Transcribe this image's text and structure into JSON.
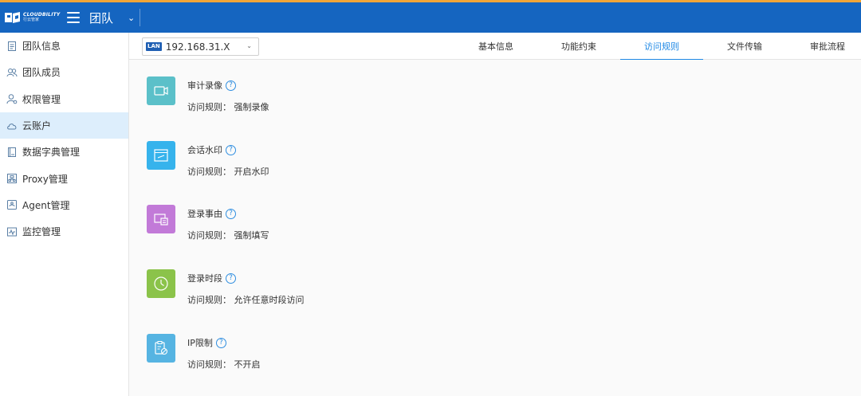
{
  "header": {
    "logo_en": "CLOUDBILITY",
    "logo_cn": "行云管家",
    "title": "团队"
  },
  "sidebar": {
    "items": [
      {
        "label": "团队信息",
        "icon": "document-icon"
      },
      {
        "label": "团队成员",
        "icon": "users-icon"
      },
      {
        "label": "权限管理",
        "icon": "user-permission-icon"
      },
      {
        "label": "云账户",
        "icon": "cloud-icon",
        "active": true
      },
      {
        "label": "数据字典管理",
        "icon": "book-icon"
      },
      {
        "label": "Proxy管理",
        "icon": "proxy-icon"
      },
      {
        "label": "Agent管理",
        "icon": "agent-icon"
      },
      {
        "label": "监控管理",
        "icon": "monitor-icon"
      }
    ]
  },
  "toolbar": {
    "lan_badge": "LAN",
    "lan_value": "192.168.31.X",
    "tabs": [
      "基本信息",
      "功能约束",
      "访问规则",
      "文件传输",
      "审批流程"
    ],
    "active_tab": "访问规则"
  },
  "rules": [
    {
      "title": "审计录像",
      "desc": "访问规则： 强制录像",
      "icon": "video-icon",
      "color": "#5bc0c9"
    },
    {
      "title": "会话水印",
      "desc": "访问规则： 开启水印",
      "icon": "watermark-icon",
      "color": "#36b3ec"
    },
    {
      "title": "登录事由",
      "desc": "访问规则： 强制填写",
      "icon": "login-reason-icon",
      "color": "#c27ad8"
    },
    {
      "title": "登录时段",
      "desc": "访问规则： 允许任意时段访问",
      "icon": "clock-icon",
      "color": "#8bc34a"
    },
    {
      "title": "IP限制",
      "desc": "访问规则： 不开启",
      "icon": "ip-restriction-icon",
      "color": "#56b4e2"
    }
  ],
  "colors": {
    "topbar": "#1565c0",
    "accent_line": "#f0a538",
    "active_tab": "#1e88e5",
    "active_sidebar": "#ddeefc"
  }
}
